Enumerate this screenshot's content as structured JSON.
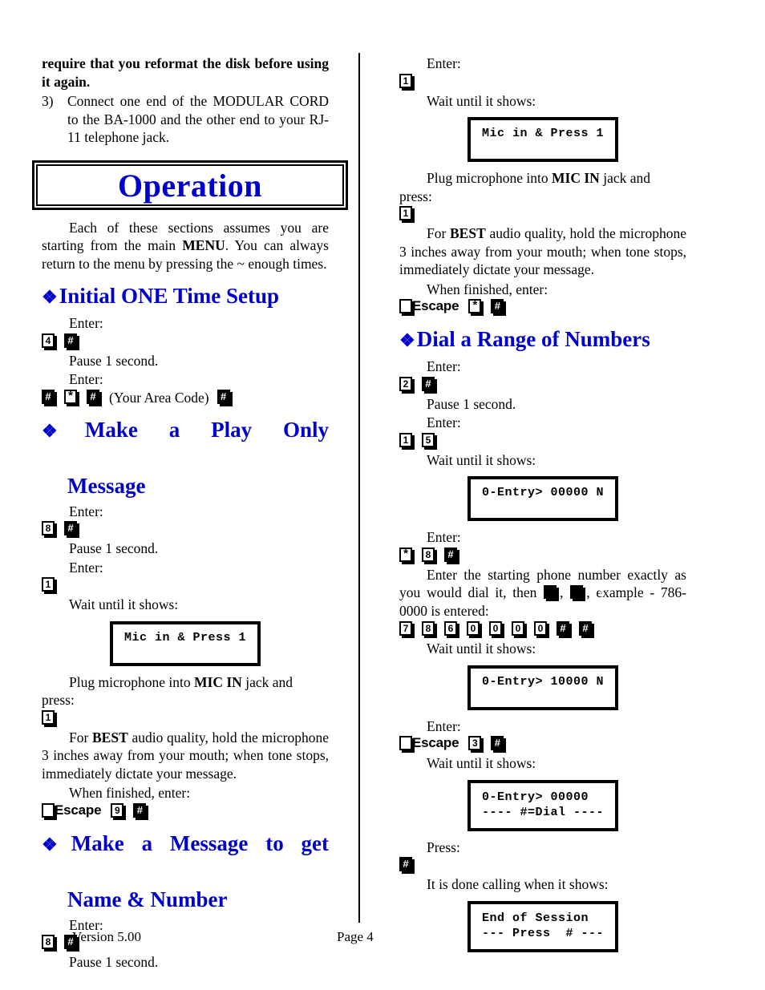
{
  "document": {
    "banner_title": "Operation",
    "footer": {
      "version": "Version 5.00",
      "page": "Page 4"
    }
  },
  "left_column": {
    "carryover_bold": "require that you reformat the disk before using it again.",
    "step3": {
      "number": "3)",
      "text": "Connect one end of the MODULAR CORD to the BA-1000 and the other end to your RJ-11 telephone jack."
    },
    "intro": {
      "part1": "Each of these sections assumes you are starting from the main ",
      "bold": "MENU",
      "part2": ".  You can always return to the menu by pressing the ~ enough times."
    },
    "sections": [
      {
        "heading": "Initial ONE Time Setup",
        "heading_line2": "",
        "steps": [
          {
            "type": "text",
            "text": "Enter:"
          },
          {
            "type": "keys",
            "keys": [
              "4",
              "#"
            ]
          },
          {
            "type": "text",
            "text": "Pause 1 second."
          },
          {
            "type": "text",
            "text": "Enter:"
          },
          {
            "type": "keys_with_note",
            "keys_before": [
              "#",
              "*",
              "#"
            ],
            "note": "(Your Area Code)",
            "keys_after": [
              "#"
            ]
          }
        ]
      },
      {
        "heading": "Make a Play Only",
        "heading_line2": "Message",
        "steps": [
          {
            "type": "text",
            "text": "Enter:"
          },
          {
            "type": "keys",
            "keys": [
              "8",
              "#"
            ]
          },
          {
            "type": "text",
            "text": "Pause 1 second."
          },
          {
            "type": "text",
            "text": "Enter:"
          },
          {
            "type": "keys",
            "keys": [
              "1"
            ]
          },
          {
            "type": "text",
            "text": "Wait until it shows:"
          },
          {
            "type": "lcd",
            "lines": [
              "Mic in & Press 1"
            ]
          },
          {
            "type": "rich_plug",
            "part1": "Plug microphone into ",
            "bold": "MIC IN",
            "part2": " jack and press:"
          },
          {
            "type": "keys",
            "keys": [
              "1"
            ]
          },
          {
            "type": "rich_best",
            "part1": "For ",
            "bold": "BEST",
            "part2": " audio quality, hold the microphone 3 inches away from your mouth; when tone stops, immediately dictate your message."
          },
          {
            "type": "text",
            "text": "When finished, enter:"
          },
          {
            "type": "escape_keys",
            "escape": "Escape",
            "keys": [
              "9",
              "#"
            ]
          }
        ]
      },
      {
        "heading": "Make a Message to get",
        "heading_line2": "Name & Number",
        "steps": [
          {
            "type": "text",
            "text": "Enter:"
          },
          {
            "type": "keys",
            "keys": [
              "8",
              "#"
            ]
          },
          {
            "type": "text",
            "text": "Pause 1 second."
          }
        ]
      }
    ]
  },
  "right_column": {
    "sections": [
      {
        "heading": "",
        "heading_line2": "",
        "steps": [
          {
            "type": "text",
            "text": "Enter:"
          },
          {
            "type": "keys",
            "keys": [
              "1"
            ]
          },
          {
            "type": "text",
            "text": "Wait until it shows:"
          },
          {
            "type": "lcd",
            "lines": [
              "Mic in & Press 1"
            ]
          },
          {
            "type": "rich_plug",
            "part1": "Plug microphone into ",
            "bold": "MIC IN",
            "part2": " jack and press:"
          },
          {
            "type": "keys",
            "keys": [
              "1"
            ]
          },
          {
            "type": "rich_best",
            "part1": "For ",
            "bold": "BEST",
            "part2": " audio quality, hold the microphone 3 inches away from your mouth; when tone stops, immediately dictate your message."
          },
          {
            "type": "text",
            "text": "When finished, enter:"
          },
          {
            "type": "escape_keys",
            "escape": "Escape",
            "keys": [
              "*",
              "#"
            ]
          }
        ]
      },
      {
        "heading": "Dial a Range of Numbers",
        "heading_line2": "",
        "steps": [
          {
            "type": "text",
            "text": "Enter:"
          },
          {
            "type": "keys",
            "keys": [
              "2",
              "#"
            ]
          },
          {
            "type": "text",
            "text": "Pause 1 second."
          },
          {
            "type": "text",
            "text": "Enter:"
          },
          {
            "type": "keys",
            "keys": [
              "1",
              "5"
            ]
          },
          {
            "type": "text",
            "text": "Wait until it shows:"
          },
          {
            "type": "lcd",
            "lines": [
              "0-Entry> 00000 N"
            ]
          },
          {
            "type": "text",
            "text": "Enter:"
          },
          {
            "type": "keys",
            "keys": [
              "*",
              "8",
              "#"
            ]
          },
          {
            "type": "rich_phone",
            "part1": "Enter the starting phone number exactly as you would dial it, then ",
            "inline_keys": [
              "#",
              "#"
            ],
            "part2": ", example - 786-0000 is entered:"
          },
          {
            "type": "keys",
            "keys": [
              "7",
              "8",
              "6",
              "0",
              "0",
              "0",
              "0",
              "#",
              "#"
            ]
          },
          {
            "type": "text",
            "text": "Wait until it shows:"
          },
          {
            "type": "lcd",
            "lines": [
              "0-Entry> 10000 N"
            ]
          },
          {
            "type": "text",
            "text": "Enter:"
          },
          {
            "type": "escape_keys",
            "escape": "Escape",
            "keys": [
              "3",
              "#"
            ]
          },
          {
            "type": "text",
            "text": "Wait until it shows:"
          },
          {
            "type": "lcd",
            "lines": [
              "0-Entry> 00000",
              "---- #=Dial ----"
            ]
          },
          {
            "type": "text",
            "text": "Press:"
          },
          {
            "type": "keys",
            "keys": [
              "#"
            ]
          },
          {
            "type": "text",
            "text": "It is done calling when it shows:"
          },
          {
            "type": "lcd",
            "lines": [
              "End of Session",
              "--- Press  # ---"
            ]
          }
        ]
      }
    ]
  }
}
